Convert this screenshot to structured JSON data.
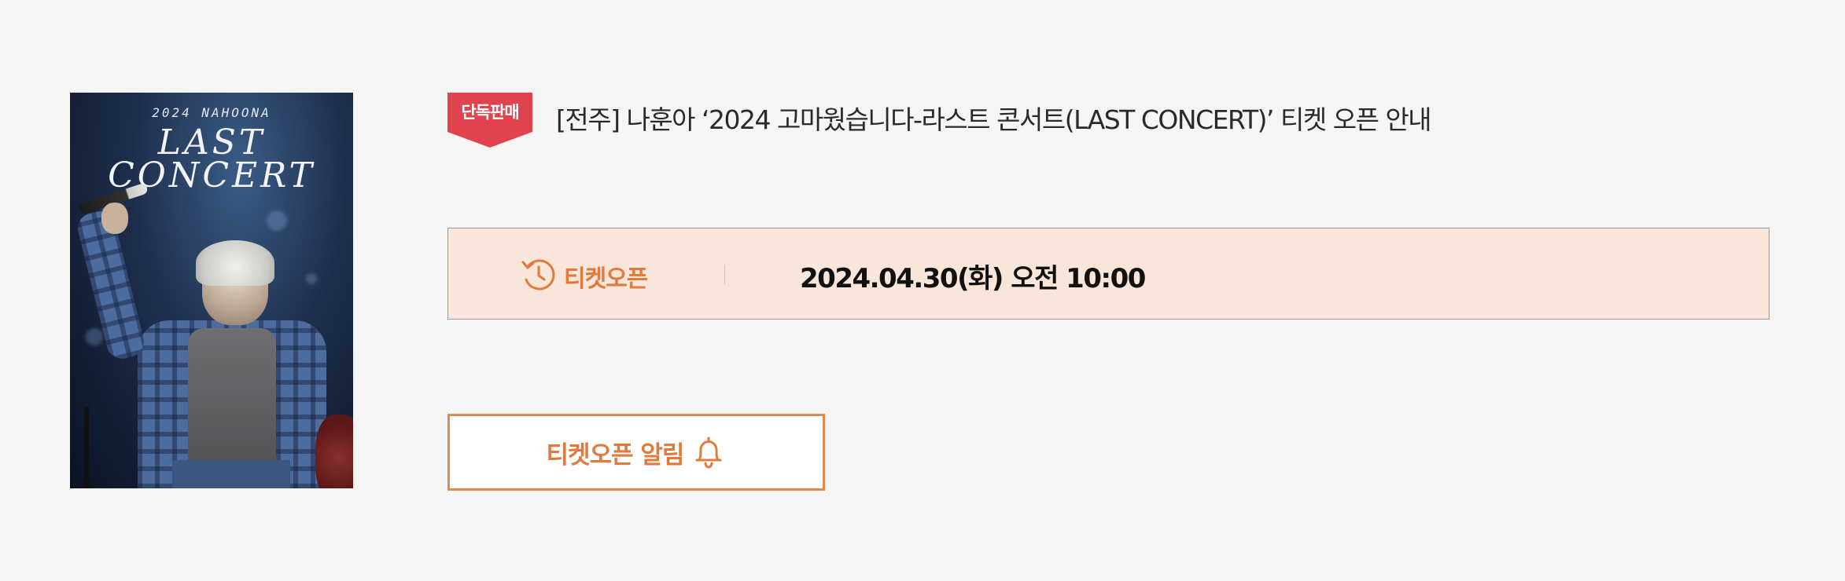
{
  "poster": {
    "year_line": "2024 NAHOONA",
    "title_line1": "LAST",
    "title_line2": "CONCERT",
    "icon": "concert-poster-image"
  },
  "badge": {
    "label": "단독판매",
    "color": "#e0434d"
  },
  "event": {
    "title": "[전주] 나훈아 ‘2024 고마웠습니다-라스트 콘서트(LAST CONCERT)’ 티켓 오픈 안내"
  },
  "ticket_open": {
    "icon": "history-clock-icon",
    "label": "티켓오픈",
    "datetime": "2024.04.30(화) 오전 10:00",
    "background": "#f8e6db",
    "accent": "#e07a3f"
  },
  "alert_button": {
    "label": "티켓오픈 알림",
    "icon": "bell-icon",
    "border_color": "#e08a50"
  }
}
